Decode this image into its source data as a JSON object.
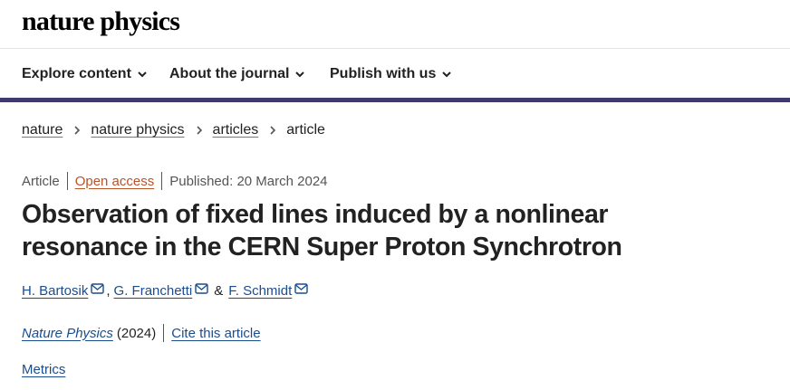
{
  "brand": {
    "name": "nature physics"
  },
  "nav": {
    "items": [
      {
        "label": "Explore content"
      },
      {
        "label": "About the journal"
      },
      {
        "label": "Publish with us"
      }
    ]
  },
  "breadcrumb": {
    "items": [
      "nature",
      "nature physics",
      "articles"
    ],
    "current": "article"
  },
  "meta": {
    "type": "Article",
    "access": "Open access",
    "published": "Published: 20 March 2024"
  },
  "article": {
    "title_line1": "Observation of fixed lines induced by a nonlinear",
    "title_line2": "resonance in the CERN Super Proton Synchrotron"
  },
  "authors": {
    "list": [
      "H. Bartosik",
      "G. Franchetti",
      "F. Schmidt"
    ],
    "comma": ",",
    "ampersand": "&"
  },
  "citation": {
    "journal": "Nature Physics",
    "year": "(2024)",
    "cite_label": "Cite this article"
  },
  "metrics_label": "Metrics",
  "colors": {
    "nav_rule": "#3e3a6d",
    "link_blue": "#1a4d8f",
    "open_access": "#b8532a"
  }
}
